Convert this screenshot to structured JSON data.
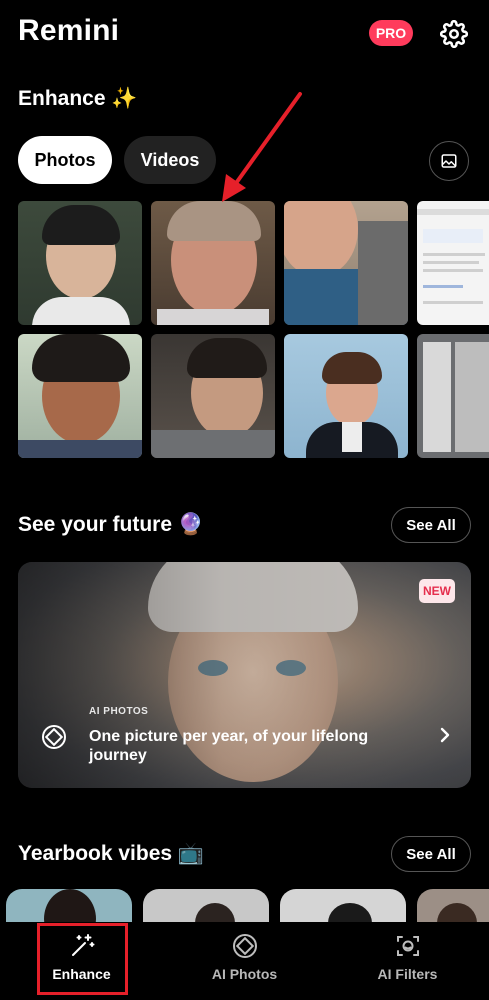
{
  "header": {
    "app_title": "Remini",
    "pro_badge": "PRO"
  },
  "enhance": {
    "title": "Enhance ✨",
    "tabs": [
      {
        "label": "Photos",
        "active": true
      },
      {
        "label": "Videos",
        "active": false
      }
    ]
  },
  "future": {
    "title": "See your future 🔮",
    "see_all": "See All",
    "promo": {
      "badge": "NEW",
      "kicker": "AI PHOTOS",
      "title": "One picture per year, of your lifelong journey"
    }
  },
  "yearbook": {
    "title": "Yearbook vibes 📺",
    "see_all": "See All"
  },
  "bottom_nav": [
    {
      "label": "Enhance",
      "icon": "magic-wand-icon",
      "active": true
    },
    {
      "label": "AI Photos",
      "icon": "ai-photos-icon",
      "active": false
    },
    {
      "label": "AI Filters",
      "icon": "ai-filters-icon",
      "active": false
    }
  ],
  "colors": {
    "accent": "#ff3b5c",
    "highlight": "#e6202a",
    "background": "#000000"
  }
}
